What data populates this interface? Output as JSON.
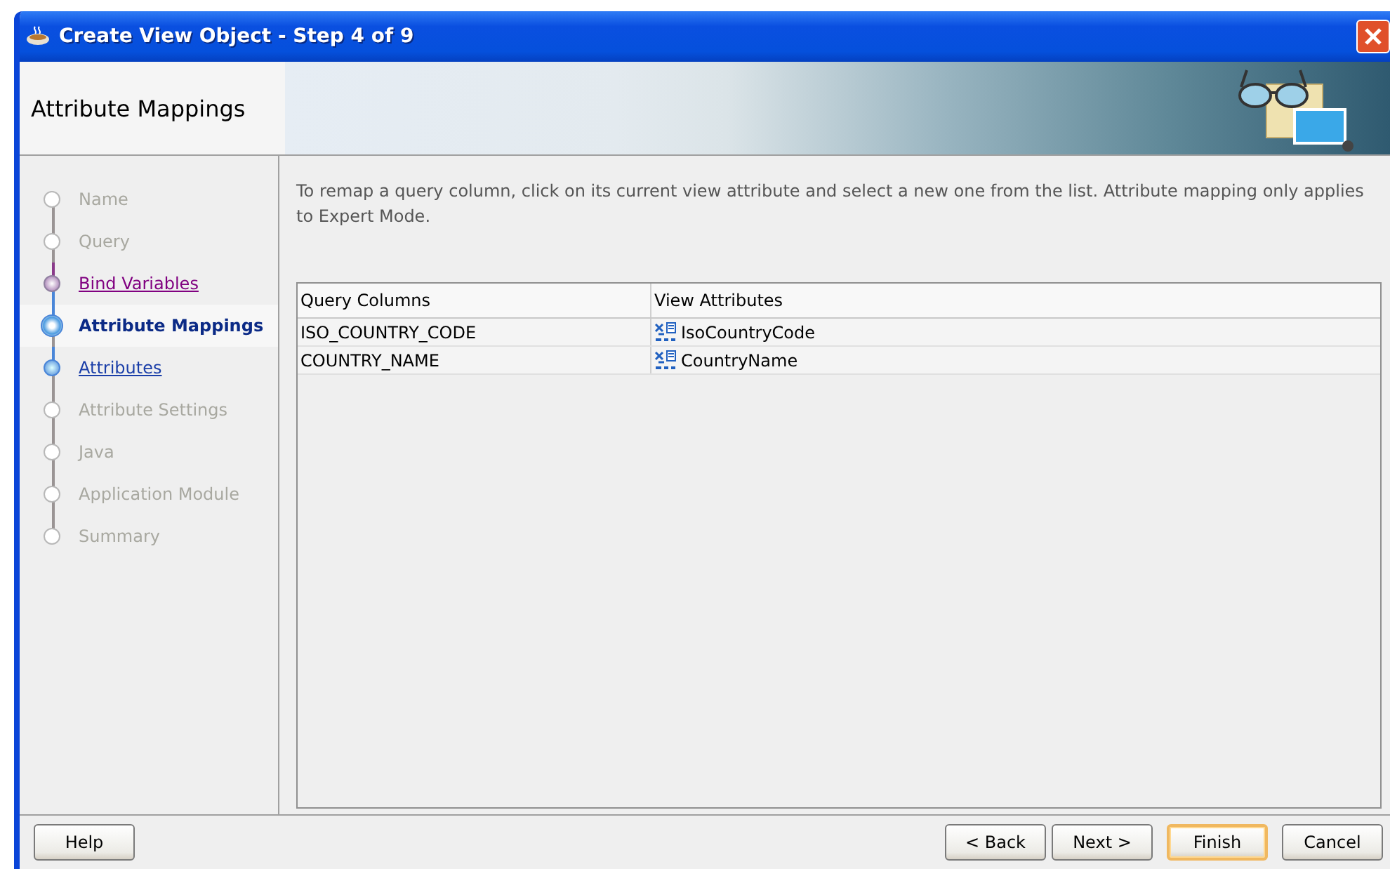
{
  "window": {
    "title": "Create View Object - Step 4 of 9"
  },
  "header": {
    "title": "Attribute Mappings"
  },
  "steps": [
    {
      "label": "Name",
      "kind": "disabled"
    },
    {
      "label": "Query",
      "kind": "disabled"
    },
    {
      "label": "Bind Variables",
      "kind": "visited"
    },
    {
      "label": "Attribute Mappings",
      "kind": "current"
    },
    {
      "label": "Attributes",
      "kind": "link"
    },
    {
      "label": "Attribute Settings",
      "kind": "disabled"
    },
    {
      "label": "Java",
      "kind": "disabled"
    },
    {
      "label": "Application Module",
      "kind": "disabled"
    },
    {
      "label": "Summary",
      "kind": "disabled"
    }
  ],
  "description": "To remap a query column, click on its current view attribute and select a new one from the list.  Attribute mapping only applies to Expert Mode.",
  "table": {
    "columns": [
      "Query Columns",
      "View Attributes"
    ],
    "rows": [
      {
        "query_column": "ISO_COUNTRY_CODE",
        "view_attribute": "IsoCountryCode"
      },
      {
        "query_column": "COUNTRY_NAME",
        "view_attribute": "CountryName"
      }
    ]
  },
  "buttons": {
    "left": [
      "Help"
    ],
    "right": [
      {
        "label": "< Back",
        "kind": "normal"
      },
      {
        "label": "Next >",
        "kind": "normal"
      },
      {
        "label": "Finish",
        "kind": "default"
      },
      {
        "label": "Cancel",
        "kind": "normal"
      }
    ]
  }
}
